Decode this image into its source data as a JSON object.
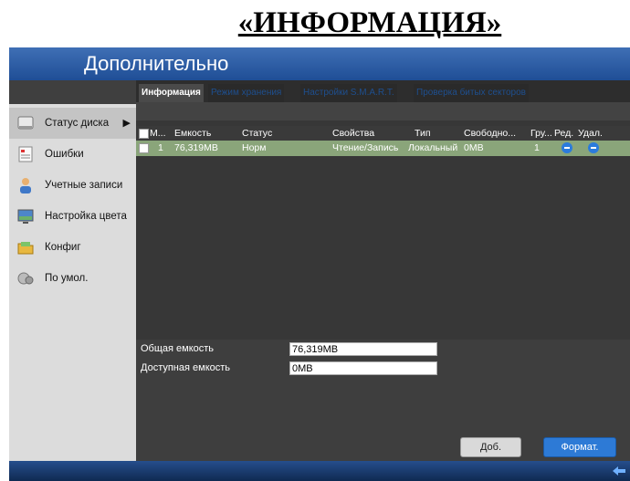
{
  "document_title": "«ИНФОРМАЦИЯ»",
  "app_title": "Дополнительно",
  "sidebar": {
    "items": [
      {
        "label": "Статус диска",
        "icon": "hard-disk-icon",
        "active": true
      },
      {
        "label": "Ошибки",
        "icon": "error-log-icon"
      },
      {
        "label": "Учетные записи",
        "icon": "user-account-icon"
      },
      {
        "label": "Настройка цвета",
        "icon": "color-settings-icon"
      },
      {
        "label": "Конфиг",
        "icon": "folder-config-icon"
      },
      {
        "label": "По умол.",
        "icon": "default-restore-icon"
      }
    ]
  },
  "tabs": [
    "Информация",
    "Режим хранения",
    "Настройки S.M.A.R.T.",
    "Проверка битых секторов"
  ],
  "table": {
    "headers": [
      "М...",
      "Емкость",
      "Статус",
      "Свойства",
      "Тип",
      "Свободно...",
      "Гру...",
      "Ред.",
      "Удал."
    ],
    "rows": [
      {
        "num": "1",
        "capacity": "76,319MB",
        "status": "Норм",
        "property": "Чтение/Запись",
        "type": "Локальный",
        "free": "0MB",
        "group": "1"
      }
    ]
  },
  "info": {
    "total_label": "Общая емкость",
    "total_value": "76,319MB",
    "free_label": "Доступная емкость",
    "free_value": "0MB"
  },
  "buttons": {
    "add": "Доб.",
    "format": "Формат."
  },
  "colors": {
    "header_blue": "#2b5ea6",
    "row_green": "#8aa57a",
    "accent_button": "#2d7ad6"
  }
}
